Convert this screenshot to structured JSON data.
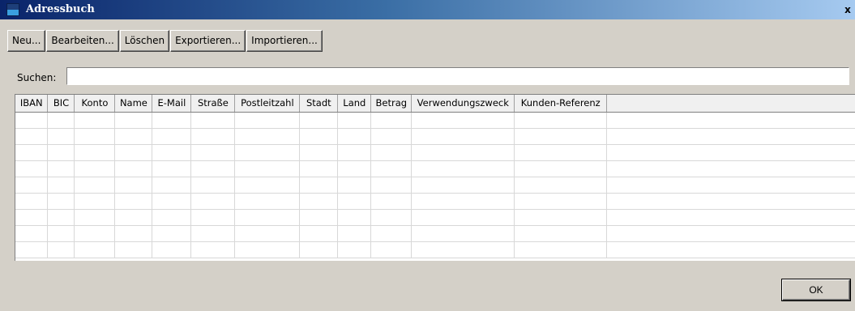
{
  "window": {
    "title": "Adressbuch",
    "close_symbol": "x",
    "icon": "app-icon"
  },
  "toolbar": {
    "buttons": [
      {
        "label": "Neu..."
      },
      {
        "label": "Bearbeiten..."
      },
      {
        "label": "Löschen"
      },
      {
        "label": "Exportieren..."
      },
      {
        "label": "Importieren..."
      }
    ]
  },
  "search": {
    "label": "Suchen:",
    "value": ""
  },
  "table": {
    "columns": [
      "IBAN",
      "BIC",
      "Konto",
      "Name",
      "E-Mail",
      "Straße",
      "Postleitzahl",
      "Stadt",
      "Land",
      "Betrag",
      "Verwendungszweck",
      "Kunden-Referenz",
      ""
    ],
    "rows": []
  },
  "footer": {
    "ok_label": "OK"
  },
  "colors": {
    "title_gradient_start": "#0a246a",
    "title_gradient_end": "#a6caf0",
    "dialog_background": "#d4d0c8"
  }
}
